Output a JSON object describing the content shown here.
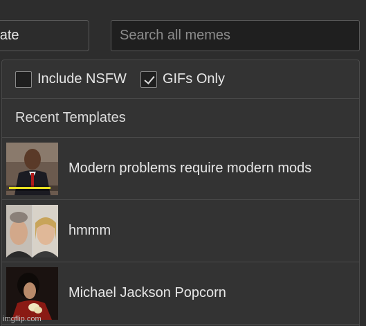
{
  "header": {
    "template_button_label": "nplate",
    "search_placeholder": "Search all memes"
  },
  "filters": {
    "nsfw": {
      "label": "Include NSFW",
      "checked": false
    },
    "gifs": {
      "label": "GIFs Only",
      "checked": true
    }
  },
  "recent": {
    "title": "Recent Templates",
    "items": [
      {
        "name": "Modern problems require modern mods",
        "thumb_icon": "man-in-suit-thumbnail"
      },
      {
        "name": "hmmm",
        "thumb_icon": "two-faces-thumbnail"
      },
      {
        "name": "Michael Jackson Popcorn",
        "thumb_icon": "popcorn-thumbnail"
      }
    ]
  },
  "watermark": "imgflip.com"
}
